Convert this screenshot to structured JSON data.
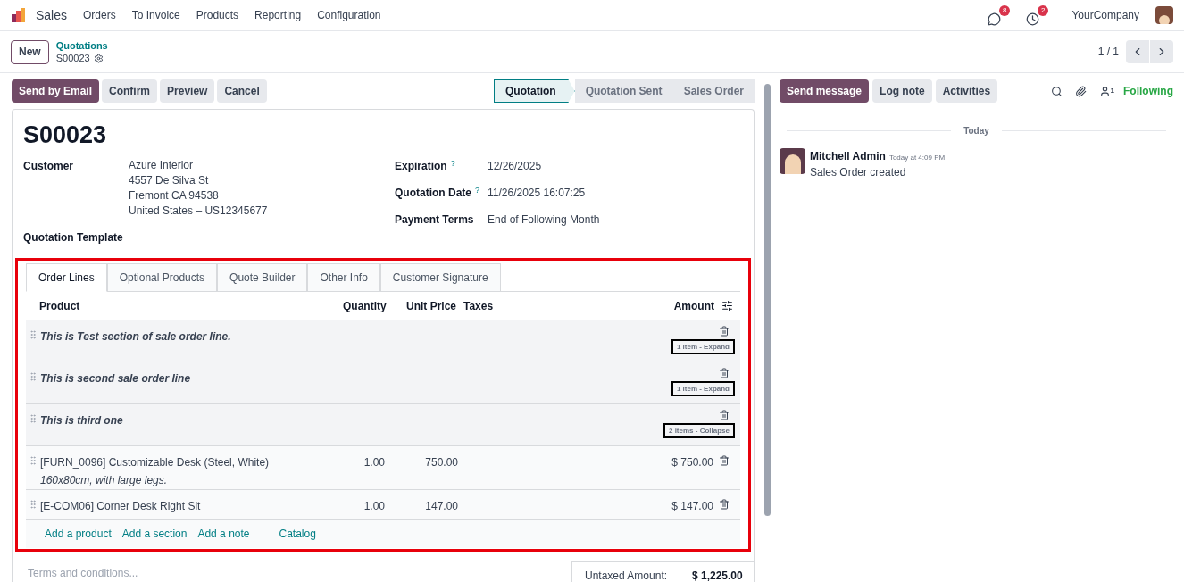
{
  "nav": {
    "app": "Sales",
    "menu": [
      "Orders",
      "To Invoice",
      "Products",
      "Reporting",
      "Configuration"
    ],
    "messages_count": "8",
    "activities_count": "2",
    "company": "YourCompany"
  },
  "control": {
    "new": "New",
    "breadcrumb": "Quotations",
    "record": "S00023",
    "pager": "1 / 1"
  },
  "actions": [
    {
      "label": "Send by Email",
      "primary": true
    },
    {
      "label": "Confirm",
      "primary": false
    },
    {
      "label": "Preview",
      "primary": false
    },
    {
      "label": "Cancel",
      "primary": false
    }
  ],
  "status": [
    {
      "label": "Quotation",
      "selected": true
    },
    {
      "label": "Quotation Sent",
      "selected": false
    },
    {
      "label": "Sales Order",
      "selected": false
    }
  ],
  "form": {
    "title": "S00023",
    "customer": {
      "label": "Customer",
      "lines": [
        "Azure Interior",
        "4557 De Silva St",
        "Fremont CA 94538",
        "United States – US12345677"
      ]
    },
    "template": {
      "label": "Quotation Template"
    },
    "right_fields": [
      {
        "label": "Expiration",
        "help": "?",
        "value": "12/26/2025"
      },
      {
        "label": "Quotation Date",
        "help": "?",
        "value": "11/26/2025 16:07:25"
      },
      {
        "label": "Payment Terms",
        "value": "End of Following Month"
      }
    ]
  },
  "notebook": {
    "highlighted": true,
    "tabs": [
      {
        "label": "Order Lines",
        "selected": true
      },
      {
        "label": "Optional Products",
        "selected": false
      },
      {
        "label": "Quote Builder",
        "selected": false
      },
      {
        "label": "Other Info",
        "selected": false
      },
      {
        "label": "Customer Signature",
        "selected": false
      }
    ],
    "columns": [
      "Product",
      "Quantity",
      "Unit Price",
      "Taxes",
      "Amount"
    ],
    "rows": [
      {
        "kind": "section",
        "name": "This is Test section of sale order line.",
        "toggle": "1 item - Expand",
        "highlighted": true
      },
      {
        "kind": "section",
        "name": "This is second sale order line",
        "toggle": "1 item - Expand",
        "highlighted": true
      },
      {
        "kind": "section",
        "name": "This is third one",
        "toggle": "2 items - Collapse",
        "highlighted": true
      },
      {
        "kind": "product",
        "name": "[FURN_0096] Customizable Desk (Steel, White)",
        "description": "160x80cm, with large legs.",
        "quantity": "1.00",
        "unit_price": "750.00",
        "amount": "$ 750.00"
      },
      {
        "kind": "product",
        "name": "[E-COM06] Corner Desk Right Sit",
        "quantity": "1.00",
        "unit_price": "147.00",
        "amount": "$ 147.00"
      }
    ],
    "add_links": [
      "Add a product",
      "Add a section",
      "Add a note",
      "Catalog"
    ]
  },
  "terms": {
    "placeholder": "Terms and conditions..."
  },
  "totals": [
    {
      "label": "Untaxed Amount:",
      "value": "$ 1,225.00"
    }
  ],
  "chatter": {
    "buttons": [
      {
        "label": "Send message",
        "primary": true
      },
      {
        "label": "Log note",
        "primary": false
      },
      {
        "label": "Activities",
        "primary": false
      }
    ],
    "followers_count": "1",
    "following": "Following",
    "date_separator": "Today",
    "messages": [
      {
        "author": "Mitchell Admin",
        "time": "Today at 4:09 PM",
        "body": "Sales Order created"
      }
    ]
  }
}
